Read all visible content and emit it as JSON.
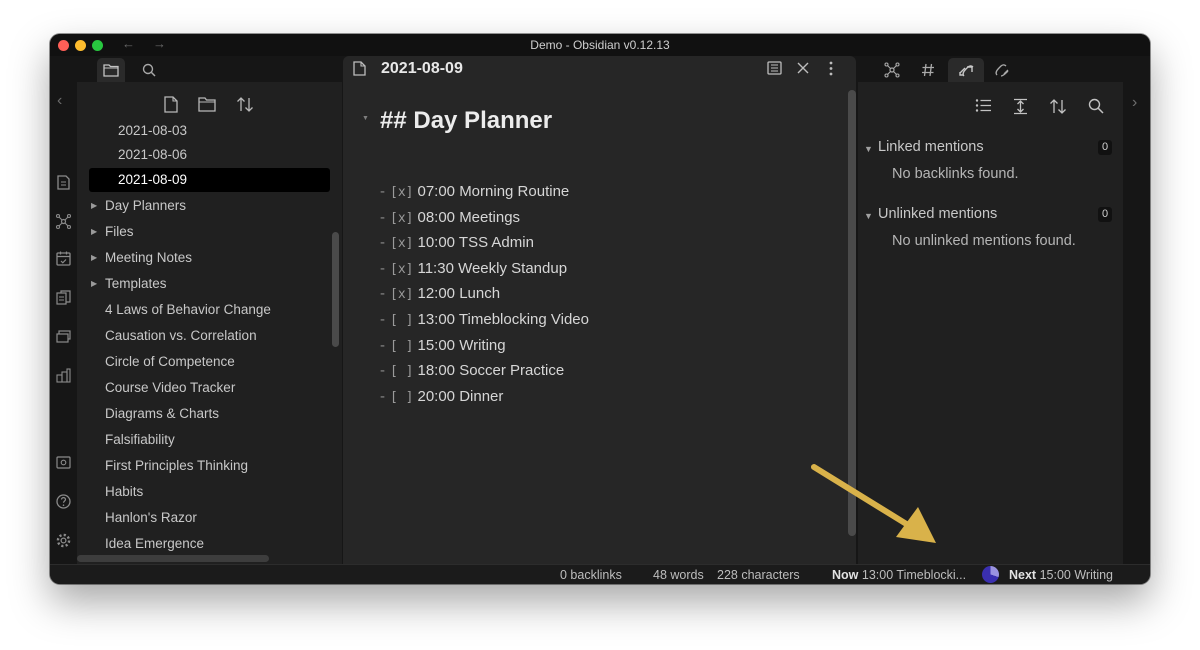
{
  "window": {
    "title": "Demo - Obsidian v0.12.13"
  },
  "editor": {
    "tab_title": "2021-08-09",
    "heading": "## Day Planner",
    "tasks": [
      {
        "box": "[x]",
        "text": "07:00 Morning Routine"
      },
      {
        "box": "[x]",
        "text": "08:00 Meetings"
      },
      {
        "box": "[x]",
        "text": "10:00 TSS Admin"
      },
      {
        "box": "[x]",
        "text": "11:30 Weekly Standup"
      },
      {
        "box": "[x]",
        "text": "12:00 Lunch"
      },
      {
        "box": "[ ]",
        "text": "13:00 Timeblocking Video"
      },
      {
        "box": "[ ]",
        "text": "15:00 Writing"
      },
      {
        "box": "[ ]",
        "text": "18:00 Soccer Practice"
      },
      {
        "box": "[ ]",
        "text": "20:00 Dinner"
      }
    ]
  },
  "sidebar": {
    "items": [
      {
        "label": "2021-08-03"
      },
      {
        "label": "2021-08-06"
      },
      {
        "label": "2021-08-09",
        "active": true
      },
      {
        "label": "Day Planners"
      },
      {
        "label": "Files"
      },
      {
        "label": "Meeting Notes"
      },
      {
        "label": "Templates"
      },
      {
        "label": "4 Laws of Behavior Change"
      },
      {
        "label": "Causation vs. Correlation"
      },
      {
        "label": "Circle of Competence"
      },
      {
        "label": "Course Video Tracker"
      },
      {
        "label": "Diagrams & Charts"
      },
      {
        "label": "Falsifiability"
      },
      {
        "label": "First Principles Thinking"
      },
      {
        "label": "Habits"
      },
      {
        "label": "Hanlon's Razor"
      },
      {
        "label": "Idea Emergence"
      }
    ]
  },
  "backlinks": {
    "linked_title": "Linked mentions",
    "linked_count": "0",
    "linked_empty": "No backlinks found.",
    "unlinked_title": "Unlinked mentions",
    "unlinked_count": "0",
    "unlinked_empty": "No unlinked mentions found."
  },
  "status": {
    "backlinks": "0 backlinks",
    "words": "48 words",
    "characters": "228 characters",
    "now_label": "Now",
    "now_text": "13:00 Timeblocki...",
    "next_label": "Next",
    "next_text": "15:00 Writing"
  },
  "colors": {
    "accent": "#9a93e0",
    "annotation_arrow": "#d9b24a"
  }
}
